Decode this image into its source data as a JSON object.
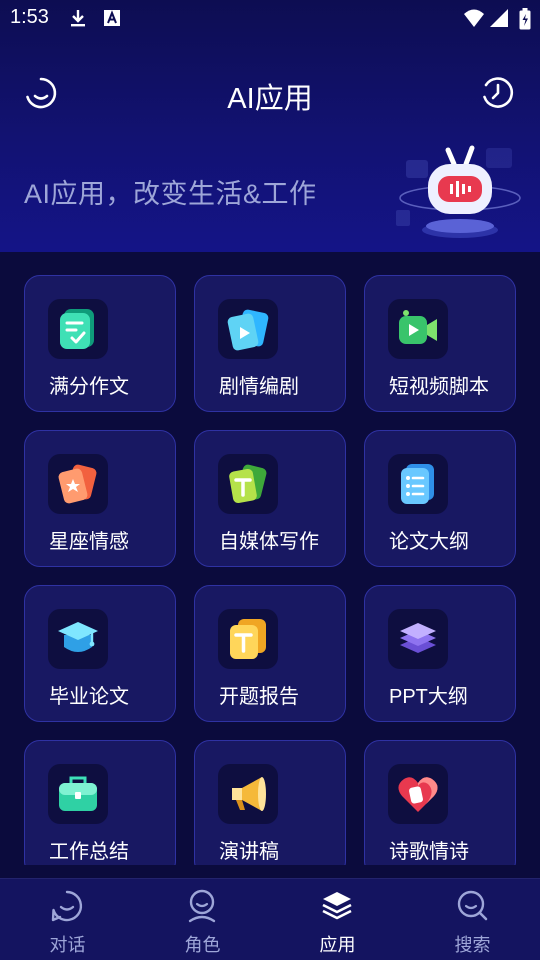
{
  "status_bar": {
    "time": "1:53",
    "icons": [
      "download-icon",
      "font-a-icon",
      "wifi-icon",
      "signal-icon",
      "battery-icon"
    ]
  },
  "header": {
    "title": "AI应用",
    "left_icon": "smile-chat-icon",
    "right_icon": "clock-history-icon"
  },
  "banner": {
    "tagline": "AI应用，改变生活&工作"
  },
  "apps": [
    {
      "label": "满分作文",
      "icon": "essay-doc-icon"
    },
    {
      "label": "剧情编剧",
      "icon": "play-cards-icon"
    },
    {
      "label": "短视频脚本",
      "icon": "video-camera-icon"
    },
    {
      "label": "星座情感",
      "icon": "star-cards-icon"
    },
    {
      "label": "自媒体写作",
      "icon": "text-cards-icon"
    },
    {
      "label": "论文大纲",
      "icon": "list-doc-icon"
    },
    {
      "label": "毕业论文",
      "icon": "graduation-cap-icon"
    },
    {
      "label": "开题报告",
      "icon": "report-doc-icon"
    },
    {
      "label": "PPT大纲",
      "icon": "layers-icon"
    },
    {
      "label": "工作总结",
      "icon": "briefcase-icon"
    },
    {
      "label": "演讲稿",
      "icon": "megaphone-icon"
    },
    {
      "label": "诗歌情诗",
      "icon": "heart-icon"
    }
  ],
  "bottom_nav": {
    "items": [
      {
        "label": "对话",
        "icon": "chat-icon",
        "active": false
      },
      {
        "label": "角色",
        "icon": "person-icon",
        "active": false
      },
      {
        "label": "应用",
        "icon": "layers-stack-icon",
        "active": true
      },
      {
        "label": "搜索",
        "icon": "search-icon",
        "active": false
      }
    ]
  },
  "colors": {
    "background": "#0b0b3d",
    "card": "#181862",
    "card_border": "#2f32a3",
    "tagline": "#9ea6d8",
    "nav_inactive": "#9ea6d8",
    "nav_active": "#ffffff"
  }
}
